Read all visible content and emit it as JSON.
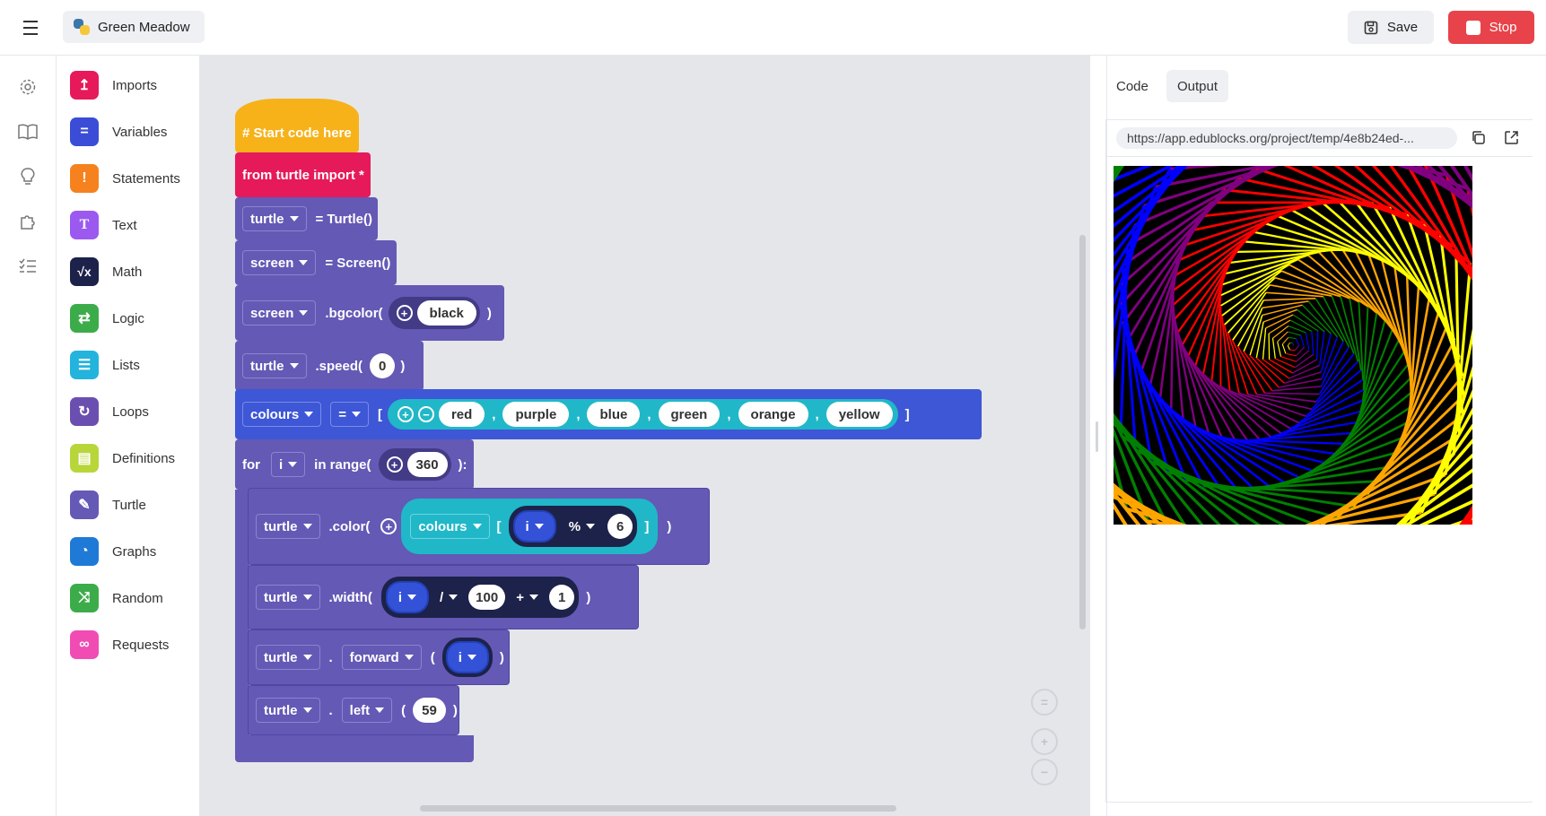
{
  "header": {
    "project_name": "Green Meadow",
    "save_label": "Save",
    "stop_label": "Stop"
  },
  "categories": [
    {
      "label": "Imports",
      "color": "#e6195a",
      "icon": "upload-icon"
    },
    {
      "label": "Variables",
      "color": "#3b4cd6",
      "icon": "equals-icon"
    },
    {
      "label": "Statements",
      "color": "#f5821f",
      "icon": "exclamation-icon"
    },
    {
      "label": "Text",
      "color": "#9b59f0",
      "icon": "text-icon"
    },
    {
      "label": "Math",
      "color": "#1d224a",
      "icon": "sqrt-icon"
    },
    {
      "label": "Logic",
      "color": "#3cac4a",
      "icon": "swap-icon"
    },
    {
      "label": "Lists",
      "color": "#22b4dc",
      "icon": "list-icon"
    },
    {
      "label": "Loops",
      "color": "#6a4fb0",
      "icon": "loop-icon"
    },
    {
      "label": "Definitions",
      "color": "#b8d63a",
      "icon": "definition-icon"
    },
    {
      "label": "Turtle",
      "color": "#6459b5",
      "icon": "pen-icon"
    },
    {
      "label": "Graphs",
      "color": "#1e7ad6",
      "icon": "pie-icon"
    },
    {
      "label": "Random",
      "color": "#3cac4a",
      "icon": "shuffle-icon"
    },
    {
      "label": "Requests",
      "color": "#f04cb4",
      "icon": "link-icon"
    }
  ],
  "blocks": {
    "comment": "# Start code here",
    "import": "from turtle import *",
    "turtle_var": "turtle",
    "turtle_ctor": "= Turtle()",
    "screen_var": "screen",
    "screen_ctor": "= Screen()",
    "bgcolor_fn": ".bgcolor(",
    "bgcolor_val": "black",
    "speed_fn": ".speed(",
    "speed_val": "0",
    "colours_var": "colours",
    "equals": "=",
    "colours": [
      "red",
      "purple",
      "blue",
      "green",
      "orange",
      "yellow"
    ],
    "for_kw": "for",
    "loop_var": "i",
    "in_range": "in range(",
    "range_val": "360",
    "colon_close": "):",
    "color_fn": ".color(",
    "mod_op": "%",
    "mod_val": "6",
    "width_fn": ".width(",
    "div_op": "/",
    "div_val": "100",
    "plus_op": "+",
    "plus_val": "1",
    "dot": ".",
    "forward": "forward",
    "left": "left",
    "left_val": "59",
    "open_paren": "(",
    "close_paren": ")",
    "open_bracket": "[",
    "close_bracket": "]",
    "comma": ","
  },
  "output": {
    "tab_code": "Code",
    "tab_output": "Output",
    "url": "https://app.edublocks.org/project/temp/4e8b24ed-..."
  },
  "colors": {
    "turtle_spiral": [
      "red",
      "purple",
      "blue",
      "green",
      "orange",
      "yellow"
    ],
    "stop": "#e8434a"
  }
}
